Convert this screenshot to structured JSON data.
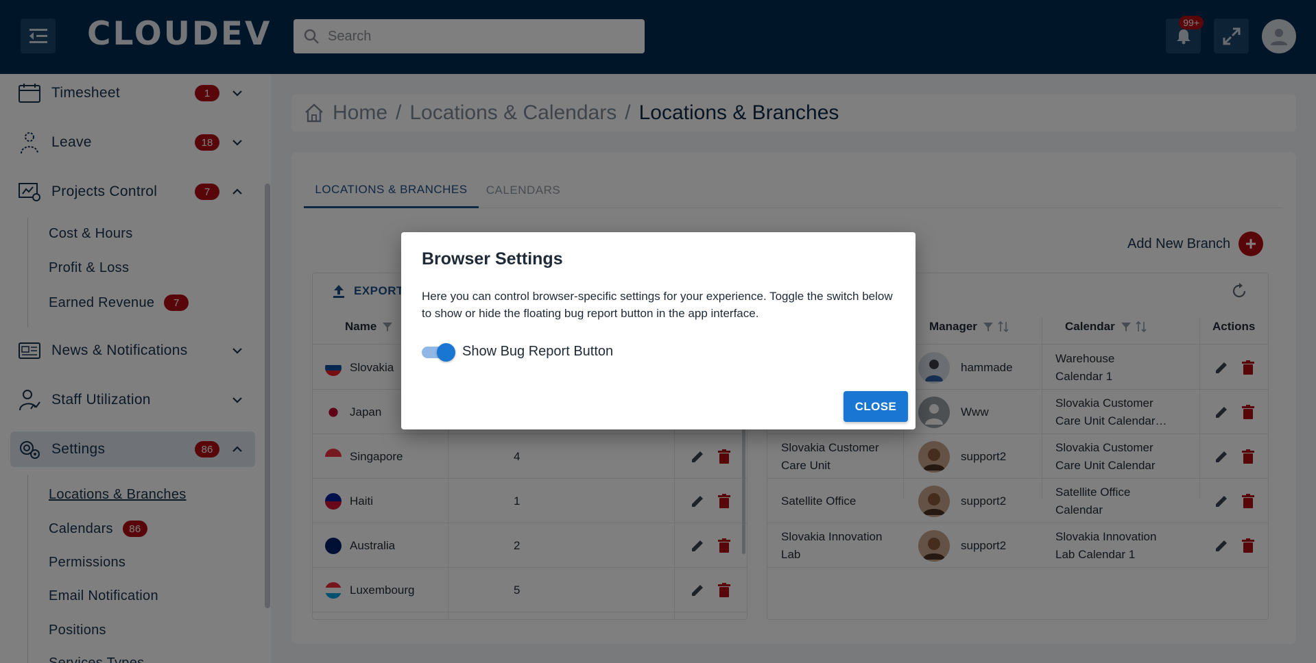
{
  "header": {
    "logo": "CLOUDEV",
    "search_placeholder": "Search",
    "notifications_badge": "99+"
  },
  "sidebar": {
    "items": [
      {
        "label": "Timesheet",
        "badge": "1"
      },
      {
        "label": "Leave",
        "badge": "18"
      },
      {
        "label": "Projects Control",
        "badge": "7"
      },
      {
        "label": "News & Notifications"
      },
      {
        "label": "Staff Utilization"
      },
      {
        "label": "Settings",
        "badge": "86"
      }
    ],
    "projects_sub": [
      {
        "label": "Cost & Hours"
      },
      {
        "label": "Profit & Loss"
      },
      {
        "label": "Earned Revenue",
        "badge": "7"
      }
    ],
    "settings_sub": [
      {
        "label": "Locations & Branches"
      },
      {
        "label": "Calendars",
        "badge": "86"
      },
      {
        "label": "Permissions"
      },
      {
        "label": "Email Notification"
      },
      {
        "label": "Positions"
      },
      {
        "label": "Services Types"
      }
    ]
  },
  "breadcrumb": {
    "home": "Home",
    "parent": "Locations & Calendars",
    "current": "Locations & Branches",
    "sep": "/"
  },
  "tabs": [
    "LOCATIONS & BRANCHES",
    "CALENDARS"
  ],
  "add_branch": "Add New Branch",
  "locations_table": {
    "export": "EXPORT",
    "header_name": "Name",
    "rows": [
      {
        "name": "Slovakia",
        "count": ""
      },
      {
        "name": "Japan",
        "count": ""
      },
      {
        "name": "Singapore",
        "count": "4"
      },
      {
        "name": "Haiti",
        "count": "1"
      },
      {
        "name": "Australia",
        "count": "2"
      },
      {
        "name": "Luxembourg",
        "count": "5"
      }
    ]
  },
  "branches_table": {
    "headers": {
      "manager": "Manager",
      "calendar": "Calendar",
      "actions": "Actions"
    },
    "rows": [
      {
        "branch_l1": "",
        "branch_l2": "",
        "manager": "hammade",
        "cal_l1": "Warehouse",
        "cal_l2": "Calendar 1"
      },
      {
        "branch_l1": "",
        "branch_l2": "",
        "manager": "Www",
        "cal_l1": "Slovakia Customer",
        "cal_l2": "Care Unit Calendar…"
      },
      {
        "branch_l1": "Slovakia Customer",
        "branch_l2": "Care Unit",
        "manager": "support2",
        "cal_l1": "Slovakia Customer",
        "cal_l2": "Care Unit Calendar"
      },
      {
        "branch_l1": "Satellite Office",
        "branch_l2": "",
        "manager": "support2",
        "cal_l1": "Satellite Office",
        "cal_l2": "Calendar"
      },
      {
        "branch_l1": "Slovakia Innovation",
        "branch_l2": "Lab",
        "manager": "support2",
        "cal_l1": "Slovakia Innovation",
        "cal_l2": "Lab Calendar 1"
      }
    ]
  },
  "dialog": {
    "title": "Browser Settings",
    "text": "Here you can control browser-specific settings for your experience. Toggle the switch below to show or hide the floating bug report button in the app interface.",
    "toggle_label": "Show Bug Report Button",
    "toggle_on": true,
    "close": "CLOSE"
  },
  "colors": {
    "header_bg": "#002a4f",
    "badge_red": "#b00d12",
    "primary": "#1976d2"
  }
}
